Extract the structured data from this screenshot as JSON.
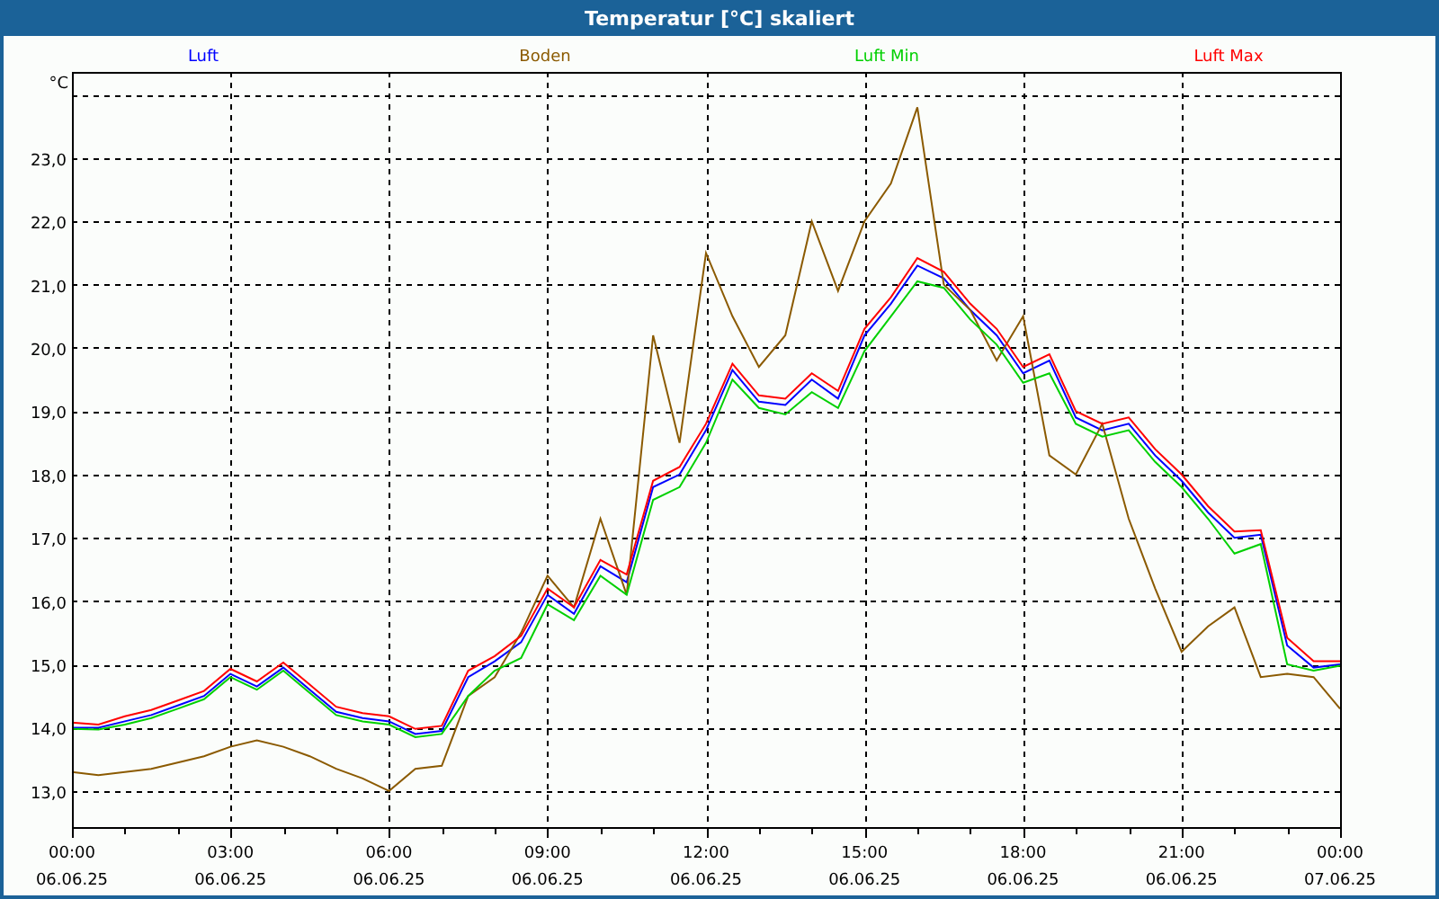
{
  "window": {
    "title": "Temperatur [°C] skaliert"
  },
  "chart": {
    "chart_data": {
      "type": "line",
      "ylabel": "°C",
      "grid": true,
      "categories": [
        "00:00\n06.06.25",
        null,
        null,
        null,
        null,
        null,
        "03:00\n06.06.25",
        null,
        null,
        null,
        null,
        null,
        "06:00\n06.06.25",
        null,
        null,
        null,
        null,
        null,
        "09:00\n06.06.25",
        null,
        null,
        null,
        null,
        null,
        "12:00\n06.06.25",
        null,
        null,
        null,
        null,
        null,
        "15:00\n06.06.25",
        null,
        null,
        null,
        null,
        null,
        "18:00\n06.06.25",
        null,
        null,
        null,
        null,
        null,
        "21:00\n06.06.25",
        null,
        null,
        null,
        null,
        null,
        "00:00\n07.06.25"
      ],
      "series": [
        {
          "name": "Luft",
          "color": "#0000ff",
          "values": [
            14.0,
            14.0,
            14.1,
            14.2,
            14.35,
            14.5,
            14.85,
            14.65,
            14.95,
            14.6,
            14.25,
            14.15,
            14.1,
            13.9,
            13.95,
            14.8,
            15.05,
            15.35,
            16.1,
            15.8,
            16.55,
            16.3,
            17.8,
            18.0,
            18.7,
            19.65,
            19.15,
            19.1,
            19.5,
            19.2,
            20.2,
            20.7,
            21.3,
            21.1,
            20.6,
            20.2,
            19.6,
            19.8,
            18.9,
            18.7,
            18.8,
            18.3,
            17.9,
            17.4,
            17.0,
            17.05,
            15.3,
            14.95,
            15.0
          ]
        },
        {
          "name": "Boden",
          "color": "#8b5a00",
          "values": [
            13.3,
            13.25,
            13.3,
            13.35,
            13.45,
            13.55,
            13.7,
            13.8,
            13.7,
            13.55,
            13.35,
            13.2,
            13.0,
            13.35,
            13.4,
            14.5,
            14.8,
            15.5,
            16.4,
            15.9,
            17.3,
            16.1,
            20.2,
            18.5,
            21.5,
            20.5,
            19.7,
            20.2,
            22.0,
            20.9,
            22.0,
            22.6,
            23.8,
            21.0,
            20.6,
            19.8,
            20.5,
            18.3,
            18.0,
            18.8,
            17.3,
            16.2,
            15.2,
            15.6,
            15.9,
            14.8,
            14.85,
            14.8,
            14.3
          ]
        },
        {
          "name": "Luft Min",
          "color": "#00d000",
          "values": [
            13.98,
            13.97,
            14.05,
            14.15,
            14.3,
            14.45,
            14.8,
            14.6,
            14.9,
            14.55,
            14.2,
            14.1,
            14.05,
            13.85,
            13.9,
            14.5,
            14.9,
            15.1,
            15.95,
            15.7,
            16.4,
            16.1,
            17.6,
            17.8,
            18.5,
            19.5,
            19.05,
            18.95,
            19.3,
            19.05,
            19.95,
            20.5,
            21.05,
            20.95,
            20.45,
            20.05,
            19.45,
            19.6,
            18.8,
            18.6,
            18.7,
            18.2,
            17.8,
            17.3,
            16.75,
            16.9,
            15.0,
            14.9,
            14.98
          ]
        },
        {
          "name": "Luft Max",
          "color": "#ff0000",
          "values": [
            14.08,
            14.05,
            14.18,
            14.28,
            14.43,
            14.58,
            14.93,
            14.73,
            15.03,
            14.68,
            14.33,
            14.23,
            14.18,
            13.98,
            14.03,
            14.9,
            15.13,
            15.45,
            16.2,
            15.9,
            16.65,
            16.42,
            17.9,
            18.12,
            18.8,
            19.75,
            19.25,
            19.2,
            19.6,
            19.32,
            20.3,
            20.8,
            21.42,
            21.2,
            20.7,
            20.3,
            19.7,
            19.9,
            19.0,
            18.8,
            18.9,
            18.4,
            18.0,
            17.5,
            17.1,
            17.12,
            15.42,
            15.05,
            15.05
          ]
        }
      ],
      "ylim": [
        12.43,
        24.36
      ],
      "yticks": [
        {
          "value": 13,
          "label": "13,0"
        },
        {
          "value": 14,
          "label": "14,0"
        },
        {
          "value": 15,
          "label": "15,0"
        },
        {
          "value": 16,
          "label": "16,0"
        },
        {
          "value": 17,
          "label": "17,0"
        },
        {
          "value": 18,
          "label": "18,0"
        },
        {
          "value": 19,
          "label": "19,0"
        },
        {
          "value": 20,
          "label": "20,0"
        },
        {
          "value": 21,
          "label": "21,0"
        },
        {
          "value": 22,
          "label": "22,0"
        },
        {
          "value": 23,
          "label": "23,0"
        }
      ]
    }
  }
}
